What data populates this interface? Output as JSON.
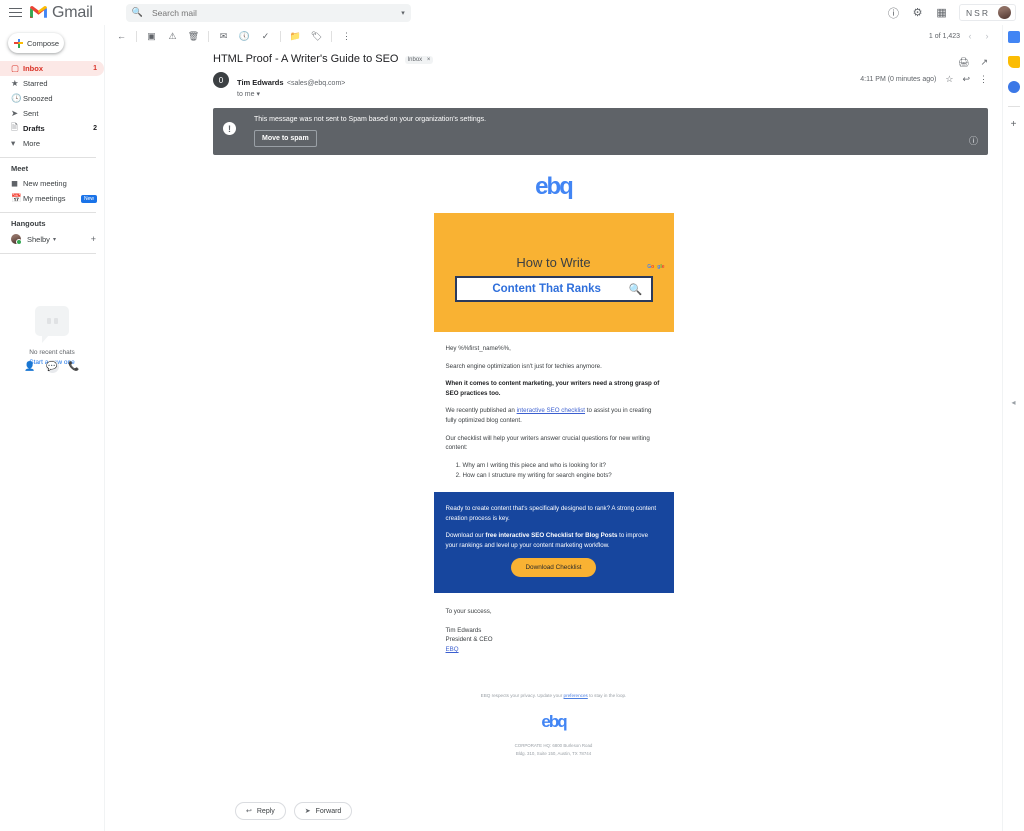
{
  "topbar": {
    "menu_icon": "hamburger-icon",
    "brand": "Gmail",
    "search_placeholder": "Search mail",
    "search_value": "",
    "search_icon": "search-icon",
    "options_caret": "▾",
    "support_icon": "help-icon",
    "settings_icon": "gear-icon",
    "apps_icon": "apps-grid-icon",
    "account_badge": "NSR"
  },
  "sidebar": {
    "compose_label": "Compose",
    "items": [
      {
        "label": "Inbox",
        "icon": "inbox-icon",
        "count": "1",
        "active": true,
        "bold": true
      },
      {
        "label": "Starred",
        "icon": "star-icon",
        "count": "",
        "active": false,
        "bold": false
      },
      {
        "label": "Snoozed",
        "icon": "clock-icon",
        "count": "",
        "active": false,
        "bold": false
      },
      {
        "label": "Sent",
        "icon": "send-icon",
        "count": "",
        "active": false,
        "bold": false
      },
      {
        "label": "Drafts",
        "icon": "drafts-icon",
        "count": "2",
        "active": false,
        "bold": true
      },
      {
        "label": "More",
        "icon": "chevron-down-icon",
        "count": "",
        "active": false,
        "bold": false
      }
    ],
    "meet": {
      "title": "Meet",
      "items": [
        {
          "label": "New meeting",
          "icon": "video-camera-icon",
          "badge": ""
        },
        {
          "label": "My meetings",
          "icon": "calendar-icon",
          "badge": "New"
        }
      ]
    },
    "hangouts": {
      "title": "Hangouts",
      "user": "Shelby",
      "caret": "▾",
      "add_icon": "plus-icon"
    },
    "chat_empty": {
      "line1": "No recent chats",
      "line2": "Start a new one"
    },
    "bottom_icons": [
      "contacts-icon",
      "hangouts-icon",
      "phone-icon"
    ]
  },
  "toolbar": {
    "icons": [
      "back-arrow-icon",
      "archive-icon",
      "report-spam-icon",
      "delete-icon",
      "mark-unread-icon",
      "snooze-icon",
      "add-to-tasks-icon",
      "move-to-icon",
      "labels-icon",
      "more-options-icon"
    ],
    "pagination": "1 of 1,423",
    "prev_icon": "chevron-left-icon",
    "next_icon": "chevron-right-icon"
  },
  "message": {
    "subject": "HTML Proof - A Writer's Guide to SEO",
    "label": "Inbox",
    "label_close": "×",
    "print_icon": "print-icon",
    "popout_icon": "open-in-new-icon",
    "sender_initial": "0",
    "sender_name": "Tim Edwards",
    "sender_email": "<sales@ebq.com>",
    "recipient": "to me",
    "recipient_caret": "▾",
    "timestamp": "4:11 PM (0 minutes ago)",
    "star_icon": "star-icon",
    "reply_icon": "reply-icon",
    "more_icon": "more-options-icon"
  },
  "spam_banner": {
    "icon": "exclamation-icon",
    "text": "This message was not sent to Spam based on your organization's settings.",
    "button_label": "Move to spam",
    "help_icon": "help-icon",
    "background": "#5f6368"
  },
  "email": {
    "logo": "ebq",
    "hero": {
      "title": "How to Write",
      "search_text": "Content That Ranks",
      "search_icon": "magnifier-icon",
      "google_label": "Google",
      "background": "#F9B233"
    },
    "body": {
      "greeting": "Hey %%first_name%%,",
      "p1": "Search engine optimization isn't just for techies anymore.",
      "p2": "When it comes to content marketing, your writers need a strong grasp of SEO practices too.",
      "p3_before": "We recently published an ",
      "p3_link": "interactive SEO checklist",
      "p3_after": " to assist you in creating fully optimized blog content.",
      "p4": "Our checklist will help your writers answer crucial questions for new writing content:",
      "list": [
        "Why am I writing this piece and who is looking for it?",
        "How can I structure my writing for search engine bots?"
      ]
    },
    "cta": {
      "p1": "Ready to create content that's specifically designed to rank? A strong content creation process is key.",
      "p2_before": "Download our ",
      "p2_bold": "free interactive SEO Checklist for Blog Posts",
      "p2_after": " to improve your rankings and level up your content marketing workflow.",
      "button_label": "Download Checklist",
      "background": "#17469E",
      "button_color": "#F9B233"
    },
    "signature": {
      "closing": "To your success,",
      "name": "Tim Edwards",
      "title": "President & CEO",
      "company_link": "EBQ"
    },
    "footer": {
      "privacy_before": "EBQ respects your privacy. Update your ",
      "privacy_link": "preferences",
      "privacy_after": " to stay in the loop.",
      "logo": "ebq",
      "address_line1": "CORPORATE HQ: 6800 Burleson Road",
      "address_line2": "Bldg. 310, Suite 150, Austin, TX 78744"
    }
  },
  "footer_actions": {
    "reply_label": "Reply",
    "reply_icon": "reply-icon",
    "forward_label": "Forward",
    "forward_icon": "forward-icon"
  },
  "right_rail": {
    "items": [
      "calendar-icon",
      "keep-icon",
      "tasks-icon"
    ],
    "add_icon": "plus-icon",
    "expand_icon": "chevron-left-icon"
  }
}
